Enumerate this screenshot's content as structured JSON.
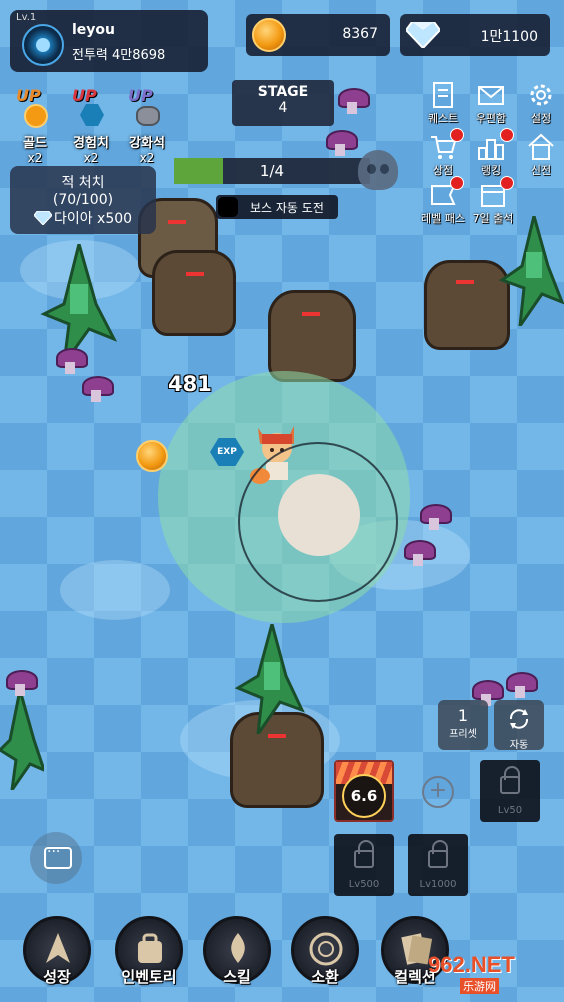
{
  "player": {
    "level": "Lv.1",
    "name": "leyou",
    "power": "전투력 4만8698"
  },
  "currency": {
    "gold": "8367",
    "diamond": "1만1100"
  },
  "buffs": [
    {
      "icon": "gold-up-icon",
      "up": "UP",
      "label": "골드",
      "mult": "x2",
      "color": "#e8892a"
    },
    {
      "icon": "exp-up-icon",
      "up": "UP",
      "label": "경험치",
      "mult": "x2",
      "color": "#d9363e"
    },
    {
      "icon": "enhance-stone-up-icon",
      "up": "UP",
      "label": "강화석",
      "mult": "x2",
      "color": "#7b6fc9"
    }
  ],
  "kill_quest": {
    "title": "적 처치",
    "count": "(70/100)",
    "reward": "다이아 x500"
  },
  "stage": {
    "label": "STAGE",
    "number": "4"
  },
  "wave_progress": {
    "text": "1/4",
    "value": 0.25
  },
  "boss_auto": {
    "label": "보스 자동 도전"
  },
  "menu": [
    {
      "icon": "quest-icon",
      "label": "퀘스트",
      "badge": false
    },
    {
      "icon": "mail-icon",
      "label": "우편함",
      "badge": false
    },
    {
      "icon": "settings-icon",
      "label": "설정",
      "badge": false
    },
    {
      "icon": "shop-icon",
      "label": "상점",
      "badge": true
    },
    {
      "icon": "ranking-icon",
      "label": "랭킹",
      "badge": true
    },
    {
      "icon": "home-icon",
      "label": "신전",
      "badge": false
    },
    {
      "icon": "level-pass-icon",
      "label": "레벨 패스",
      "badge": true
    },
    {
      "icon": "attendance-icon",
      "label": "7일 출석",
      "badge": true
    }
  ],
  "damage_popup": "481",
  "exp_gem_label": "EXP",
  "skills": {
    "preset": {
      "number": "1",
      "label": "프리셋"
    },
    "auto": {
      "label": "자동"
    },
    "active_cooldown": "6.6",
    "locked": [
      "Lv50",
      "Lv500",
      "Lv1000"
    ]
  },
  "nav": [
    {
      "icon": "growth-icon",
      "label": "성장"
    },
    {
      "icon": "inventory-icon",
      "label": "인벤토리"
    },
    {
      "icon": "skill-icon",
      "label": "스킬"
    },
    {
      "icon": "summon-icon",
      "label": "소환"
    },
    {
      "icon": "collection-icon",
      "label": "컬렉션"
    }
  ],
  "watermark": {
    "text": "962.NET",
    "sub": "乐游网"
  },
  "colors": {
    "panel": "#141c2d",
    "progress": "#5ea63b",
    "badge": "#e32020",
    "aura": "#8edcaa"
  }
}
